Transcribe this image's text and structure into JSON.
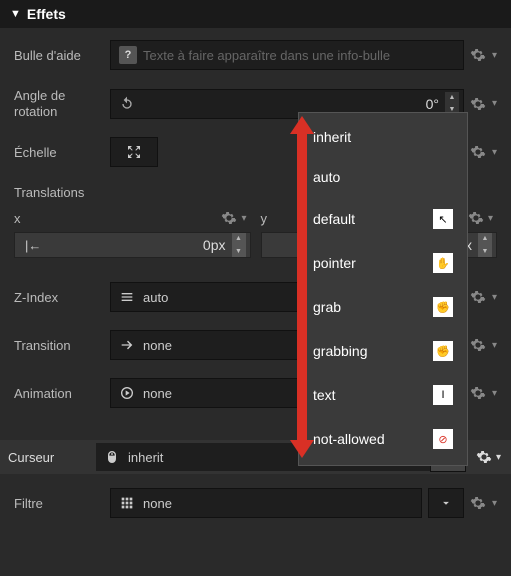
{
  "header": {
    "title": "Effets"
  },
  "tooltip": {
    "label": "Bulle d'aide",
    "placeholder": "Texte à faire apparaître dans une info-bulle"
  },
  "rotation": {
    "label": "Angle de rotation",
    "value": "0°"
  },
  "scale": {
    "label": "Échelle"
  },
  "translations": {
    "title": "Translations",
    "x_label": "x",
    "y_label": "y",
    "x_value": "0px",
    "y_suffix": "ox"
  },
  "zindex": {
    "label": "Z-Index",
    "value": "auto"
  },
  "transition": {
    "label": "Transition",
    "value": "none"
  },
  "animation": {
    "label": "Animation",
    "value": "none"
  },
  "cursor": {
    "label": "Curseur",
    "value": "inherit"
  },
  "filter": {
    "label": "Filtre",
    "value": "none"
  },
  "menu": {
    "items": [
      {
        "label": "inherit",
        "swatch": ""
      },
      {
        "label": "auto",
        "swatch": ""
      },
      {
        "label": "default",
        "swatch": "↖"
      },
      {
        "label": "pointer",
        "swatch": "✋"
      },
      {
        "label": "grab",
        "swatch": "✊"
      },
      {
        "label": "grabbing",
        "swatch": "✊"
      },
      {
        "label": "text",
        "swatch": "I"
      },
      {
        "label": "not-allowed",
        "swatch": "⊘"
      }
    ]
  }
}
